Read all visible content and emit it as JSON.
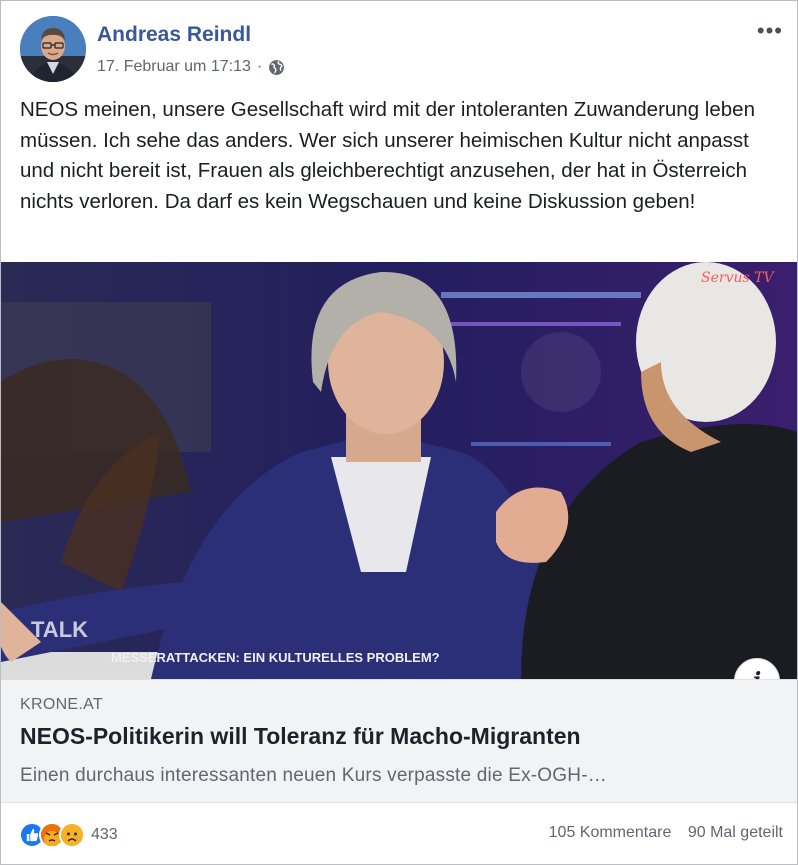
{
  "post": {
    "author": "Andreas Reindl",
    "timestamp": "17. Februar um 17:13",
    "separator": "·",
    "privacy_icon": "globe-icon",
    "more_label": "•••",
    "text": "NEOS meinen, unsere Gesellschaft wird mit der intoleranten Zuwanderung leben müssen. Ich sehe das anders. Wer sich unserer heimischen Kultur nicht anpasst und nicht bereit ist, Frauen als gleichberechtigt anzusehen, der hat in Österreich nichts verloren. Da darf es kein Wegschauen und keine Diskussion geben!"
  },
  "media": {
    "caption": "MESSERATTACKEN: EIN KULTURELLES PROBLEM?",
    "show_label": "TALK",
    "channel_logo": "Servus TV",
    "info_icon": "info-icon",
    "info_label": "i"
  },
  "link_preview": {
    "domain": "KRONE.AT",
    "headline": "NEOS-Politikerin will Toleranz für Macho-Migranten",
    "description": "Einen durchaus interessanten neuen Kurs verpasste die Ex-OGH-…"
  },
  "footer": {
    "reactions": [
      "like-icon",
      "angry-icon",
      "sad-icon"
    ],
    "reaction_count": "433",
    "comments": "105 Kommentare",
    "shares": "90 Mal geteilt"
  },
  "colors": {
    "author": "#385898",
    "secondary_text": "#606770",
    "like_blue": "#1877f2",
    "angry_orange": "#e9710f",
    "sad_yellow": "#f7b125"
  }
}
